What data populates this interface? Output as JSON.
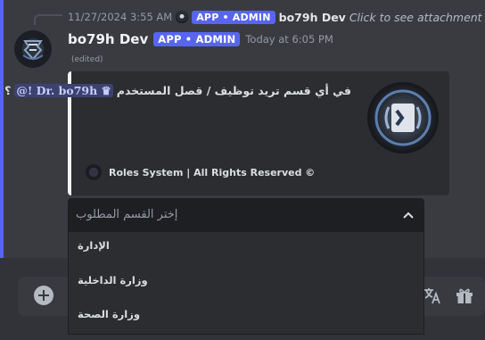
{
  "reply": {
    "timestamp": "11/27/2024 3:55 AM",
    "tag": "APP • ADMIN",
    "name": "bo79h Dev",
    "link": "Click to see attachment"
  },
  "message": {
    "author": "bo79h Dev",
    "tag": "APP • ADMIN",
    "timestamp": "Today at 6:05 PM",
    "edited": "(edited)"
  },
  "embed": {
    "question": "في أي قسم تريد توظيف / قصل المستخدم",
    "mention": "@! Dr. bo79h ♛",
    "question_mark": "؟",
    "footer": "Roles System | All Rights Reserved ©"
  },
  "select": {
    "placeholder": "إختر القسم المطلوب",
    "options": [
      {
        "label": "الإدارة"
      },
      {
        "label": "وزارة الداخلية"
      },
      {
        "label": "وزارة الصحة"
      }
    ]
  },
  "icons": {
    "attachment": "image-icon",
    "chevron": "chevron-up-icon",
    "composer_add": "plus-circle-icon",
    "translate": "translate-icon",
    "gift": "gift-icon"
  },
  "colors": {
    "accent": "#5865f2",
    "mention_bg": "#3c4270",
    "embed_bar": "#f2f3f5"
  }
}
